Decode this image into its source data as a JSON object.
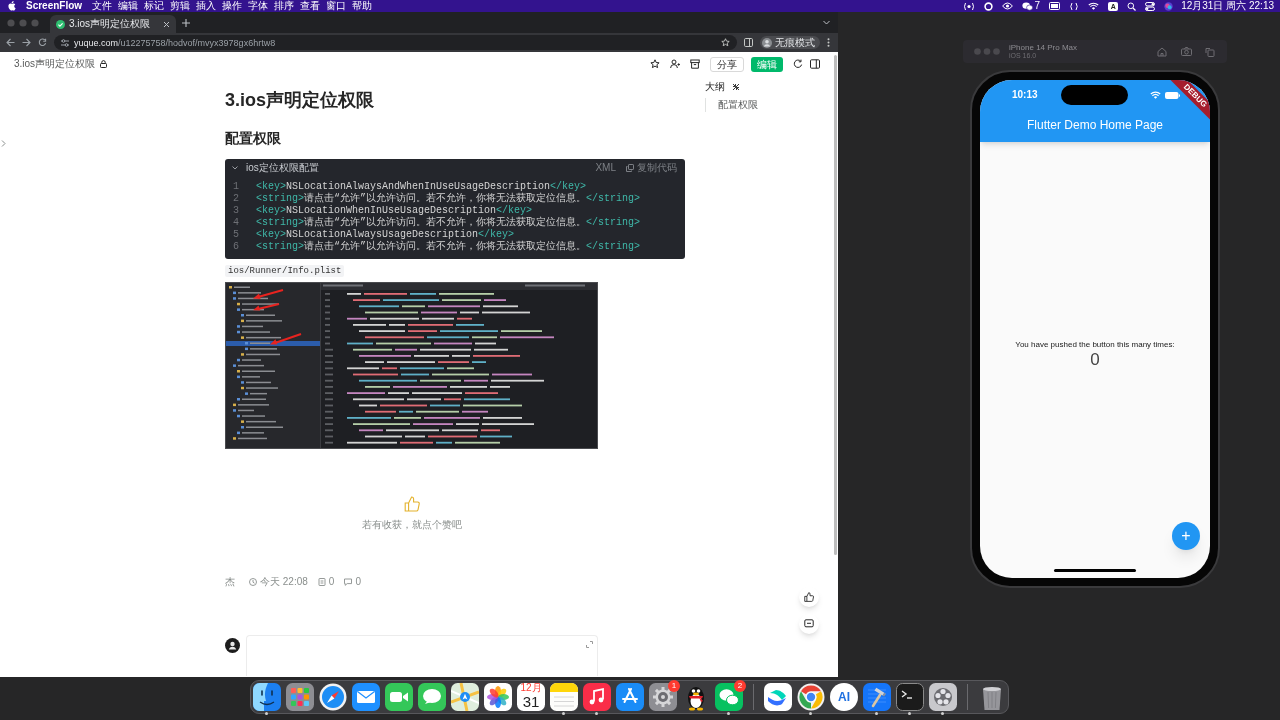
{
  "menu_bar": {
    "app_name": "ScreenFlow",
    "menus": [
      "文件",
      "编辑",
      "标记",
      "剪辑",
      "插入",
      "操作",
      "字体",
      "排序",
      "查看",
      "窗口",
      "帮助"
    ],
    "chat_count": "7",
    "input_source": "A",
    "clock": "12月31日 周六 22:13"
  },
  "browser": {
    "tabs": [
      {
        "title": "3.ios声明定位权限",
        "selected": true
      }
    ],
    "url_host": "yuque.com",
    "url_path": "/u12275758/hodvof/mvyx3978gx6hrtw8",
    "profile": "无痕模式"
  },
  "doc_header": {
    "title": "3.ios声明定位权限",
    "share": "分享",
    "edit": "编辑"
  },
  "article": {
    "title": "3.ios声明定位权限",
    "heading": "配置权限",
    "code_block": {
      "title": "ios定位权限配置",
      "language": "XML",
      "copy": "复制代码",
      "lines": [
        {
          "number": "1",
          "open": "<key>",
          "text": "NSLocationAlwaysAndWhenInUseUsageDescription",
          "close": "</key>"
        },
        {
          "number": "2",
          "open": "<string>",
          "text": "请点击“允许”以允许访问。若不允许，你将无法获取定位信息。",
          "close": "</string>"
        },
        {
          "number": "3",
          "open": "<key>",
          "text": "NSLocationWhenInUseUsageDescription",
          "close": "</key>"
        },
        {
          "number": "4",
          "open": "<string>",
          "text": "请点击“允许”以允许访问。若不允许，你将无法获取定位信息。",
          "close": "</string>"
        },
        {
          "number": "5",
          "open": "<key>",
          "text": "NSLocationAlwaysUsageDescription",
          "close": "</key>"
        },
        {
          "number": "6",
          "open": "<string>",
          "text": "请点击“允许”以允许访问。若不允许，你将无法获取定位信息。",
          "close": "</string>"
        }
      ]
    },
    "file_path": "ios/Runner/Info.plist",
    "like_prompt": "若有收获，就点个赞吧",
    "meta": {
      "author": "杰",
      "updated": "今天 22:08",
      "reads": "0",
      "comments": "0"
    }
  },
  "outline": {
    "title": "大纲",
    "items": [
      {
        "label": "配置权限"
      }
    ]
  },
  "simulator": {
    "device": "iPhone 14 Pro Max",
    "os": "iOS 16.0",
    "time": "10:13",
    "app_title": "Flutter Demo Home Page",
    "banner": "DEBUG",
    "message": "You have pushed the button this many times:",
    "counter": "0",
    "fab": "+"
  },
  "dock": {
    "items": [
      {
        "kind": "finder",
        "running": true
      },
      {
        "kind": "launchpad",
        "running": false
      },
      {
        "kind": "safari",
        "running": false
      },
      {
        "kind": "mail",
        "running": false
      },
      {
        "kind": "facetime",
        "running": false
      },
      {
        "kind": "messages",
        "running": false
      },
      {
        "kind": "maps",
        "running": false
      },
      {
        "kind": "photos",
        "running": false
      },
      {
        "kind": "calendar",
        "month": "12月",
        "day": "31",
        "running": false
      },
      {
        "kind": "notes",
        "running": true
      },
      {
        "kind": "music",
        "running": true
      },
      {
        "kind": "appstore",
        "running": false
      },
      {
        "kind": "settings",
        "badge": "1",
        "running": false
      },
      {
        "kind": "qq",
        "running": false
      },
      {
        "kind": "wechat",
        "badge": "2",
        "running": true
      },
      {
        "kind": "separator"
      },
      {
        "kind": "lark",
        "running": false
      },
      {
        "kind": "chrome",
        "running": true
      },
      {
        "kind": "ai_app",
        "label": "AI",
        "running": false
      },
      {
        "kind": "xcode",
        "running": true
      },
      {
        "kind": "terminal",
        "running": true
      },
      {
        "kind": "reel",
        "running": true
      },
      {
        "kind": "separator"
      },
      {
        "kind": "trash",
        "running": false
      }
    ]
  }
}
